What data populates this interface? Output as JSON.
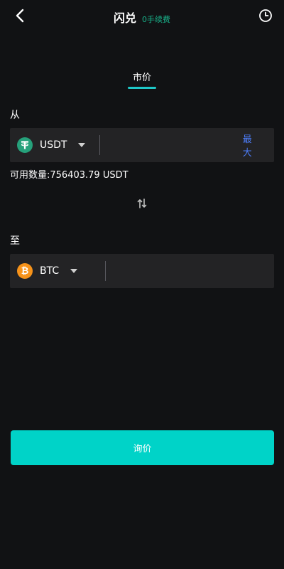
{
  "header": {
    "title": "闪兑",
    "fee_badge": "0手续费"
  },
  "tabs": [
    {
      "label": "市价",
      "active": true
    }
  ],
  "from": {
    "label": "从",
    "coin": "USDT",
    "icon": "tether-icon",
    "max_label": "最大",
    "available_label": "可用数量:",
    "available_value": "756403.79 USDT"
  },
  "to": {
    "label": "至",
    "coin": "BTC",
    "icon": "bitcoin-icon"
  },
  "submit_label": "询价",
  "colors": {
    "background": "#111214",
    "field_bg": "#232325",
    "accent": "#00d3c8",
    "fee_green": "#19b38b",
    "max_blue": "#4c7cf7",
    "usdt_green": "#26a17b",
    "btc_orange": "#f7931a"
  }
}
